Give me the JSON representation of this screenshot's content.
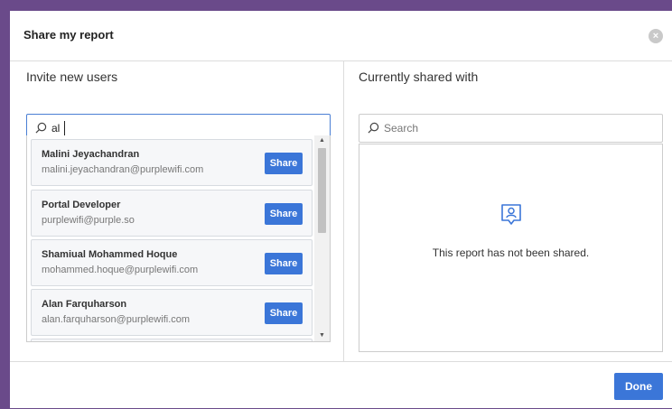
{
  "modal": {
    "title": "Share my report",
    "close_icon": "×"
  },
  "invite": {
    "heading": "Invite new users",
    "search_value": "al",
    "results": [
      {
        "name": "Malini Jeyachandran",
        "email": "malini.jeyachandran@purplewifi.com",
        "action": "Share"
      },
      {
        "name": "Portal Developer",
        "email": "purplewifi@purple.so",
        "action": "Share"
      },
      {
        "name": "Shamiual Mohammed Hoque",
        "email": "mohammed.hoque@purplewifi.com",
        "action": "Share"
      },
      {
        "name": "Alan Farquharson",
        "email": "alan.farquharson@purplewifi.com",
        "action": "Share"
      }
    ]
  },
  "shared": {
    "heading": "Currently shared with",
    "search_placeholder": "Search",
    "empty_message": "This report has not been shared."
  },
  "footer": {
    "done_label": "Done"
  },
  "colors": {
    "accent": "#3b76d8",
    "backdrop": "#6a4a8a"
  },
  "icons": {
    "search": "search-icon",
    "close": "close-icon",
    "empty_state": "user-badge-icon"
  }
}
